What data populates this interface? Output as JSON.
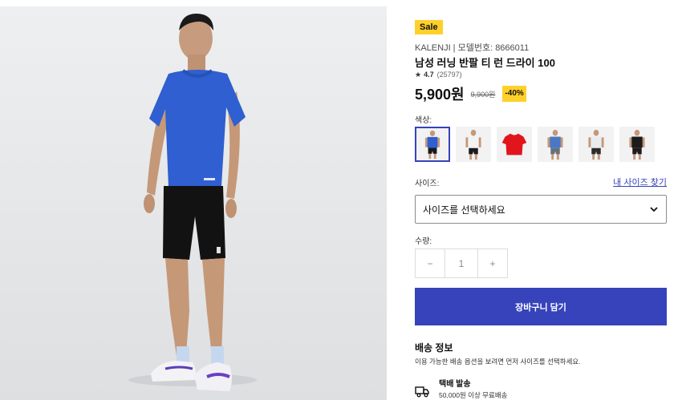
{
  "product": {
    "sale_badge": "Sale",
    "brand_line": "KALENJI | 모델번호: 8666011",
    "title": "남성 러닝 반팔 티 런 드라이 100",
    "rating_star": "★",
    "rating_score": "4.7",
    "rating_count": "(25797)",
    "price": "5,900원",
    "original_price": "9,900원",
    "discount": "-40%"
  },
  "color": {
    "label": "색상:",
    "swatches": [
      {
        "name": "blue",
        "shirt": "#2f5fd0",
        "shorts": "#1a1a1a",
        "selected": true
      },
      {
        "name": "white-black",
        "shirt": "#f3f3f3",
        "shorts": "#1a1a1a",
        "selected": false
      },
      {
        "name": "red",
        "shirt": "#e0161c",
        "shorts": null,
        "selected": false
      },
      {
        "name": "blue-grey",
        "shirt": "#4a78c4",
        "shorts": "#6a6f78",
        "selected": false
      },
      {
        "name": "white-grey",
        "shirt": "#e9ecef",
        "shorts": "#2a2a2a",
        "selected": false
      },
      {
        "name": "black",
        "shirt": "#1c1c1c",
        "shorts": "#1c1c1c",
        "selected": false
      }
    ]
  },
  "size": {
    "label": "사이즈:",
    "guide_link": "내 사이즈 찾기",
    "select_value": "사이즈를 선택하세요"
  },
  "quantity": {
    "label": "수량:",
    "minus": "−",
    "value": "1",
    "plus": "+"
  },
  "cart": {
    "button_label": "장바구니 담기"
  },
  "shipping": {
    "title": "배송 정보",
    "note": "이용 가능한 배송 옵션을 보려면 먼저 사이즈를 선택하세요.",
    "method": "택배 발송",
    "free_condition": "50,000원 이상 무료배송"
  },
  "colors": {
    "accent": "#3643ba",
    "badge": "#ffd02b"
  }
}
